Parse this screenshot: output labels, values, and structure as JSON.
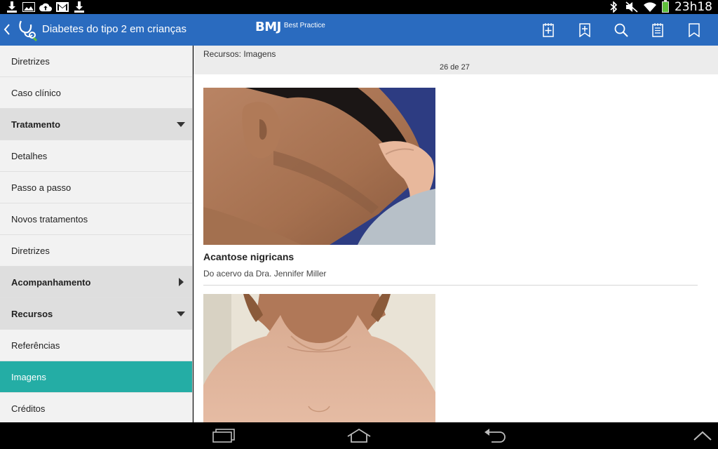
{
  "status_bar": {
    "time": "23h18",
    "left_icons": [
      "download-icon",
      "image-icon",
      "cloud-upload-icon",
      "gmail-icon",
      "download-icon"
    ],
    "right_icons": [
      "bluetooth-icon",
      "mute-icon",
      "wifi-icon",
      "battery-icon"
    ]
  },
  "action_bar": {
    "title": "Diabetes do tipo 2 em crianças",
    "brand": "BMJ",
    "brand_sub": "Best Practice",
    "actions": [
      "add-note-icon",
      "add-bookmark-icon",
      "search-icon",
      "notes-icon",
      "bookmark-icon"
    ],
    "color": "#2a6bbf"
  },
  "sidebar": {
    "items": [
      {
        "label": "Diretrizes",
        "type": "item"
      },
      {
        "label": "Caso clínico",
        "type": "item"
      },
      {
        "label": "Tratamento",
        "type": "section",
        "expanded": true
      },
      {
        "label": "Detalhes",
        "type": "item"
      },
      {
        "label": "Passo a passo",
        "type": "item"
      },
      {
        "label": "Novos tratamentos",
        "type": "item"
      },
      {
        "label": "Diretrizes",
        "type": "item"
      },
      {
        "label": "Acompanhamento",
        "type": "section",
        "expanded": false
      },
      {
        "label": "Recursos",
        "type": "section",
        "expanded": true
      },
      {
        "label": "Referências",
        "type": "item"
      },
      {
        "label": "Imagens",
        "type": "item",
        "active": true
      },
      {
        "label": "Créditos",
        "type": "item"
      }
    ],
    "active_color": "#24ada5"
  },
  "main": {
    "section_title": "Recursos: Imagens",
    "counter": "26 de 27",
    "figures": [
      {
        "title": "Acantose nigricans",
        "credit": "Do acervo da Dra. Jennifer Miller"
      }
    ]
  },
  "nav_bar": {
    "buttons": [
      "recent-apps-icon",
      "home-icon",
      "back-icon",
      "expand-up-icon"
    ]
  }
}
